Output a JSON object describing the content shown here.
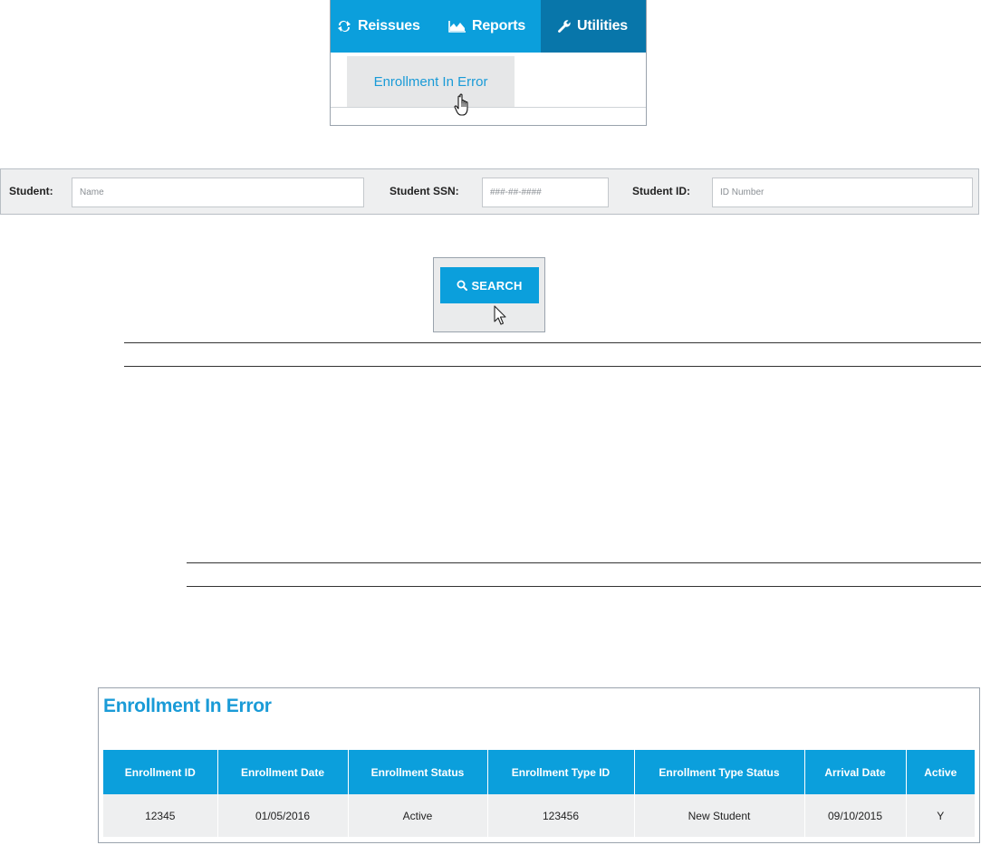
{
  "nav": {
    "items": [
      {
        "label": "Reissues",
        "icon": "refresh-icon"
      },
      {
        "label": "Reports",
        "icon": "chart-area-icon"
      },
      {
        "label": "Utilities",
        "icon": "wrench-icon",
        "active": true
      }
    ],
    "dropdown": {
      "label": "Enrollment In Error"
    },
    "colors": {
      "bar": "#0b9fdc",
      "active": "#0876aa",
      "link": "#1a9bd7"
    }
  },
  "search_fields": {
    "student": {
      "label": "Student:",
      "placeholder": "Name"
    },
    "ssn": {
      "label": "Student SSN:",
      "placeholder": "###-##-####"
    },
    "student_id": {
      "label": "Student ID:",
      "placeholder": "ID Number"
    }
  },
  "search_button": {
    "label": "SEARCH",
    "icon": "search-icon"
  },
  "results": {
    "title": "Enrollment In Error",
    "columns": [
      "Enrollment ID",
      "Enrollment Date",
      "Enrollment Status",
      "Enrollment Type ID",
      "Enrollment Type Status",
      "Arrival Date",
      "Active"
    ],
    "rows": [
      [
        "12345",
        "01/05/2016",
        "Active",
        "123456",
        "New Student",
        "09/10/2015",
        "Y"
      ]
    ]
  }
}
